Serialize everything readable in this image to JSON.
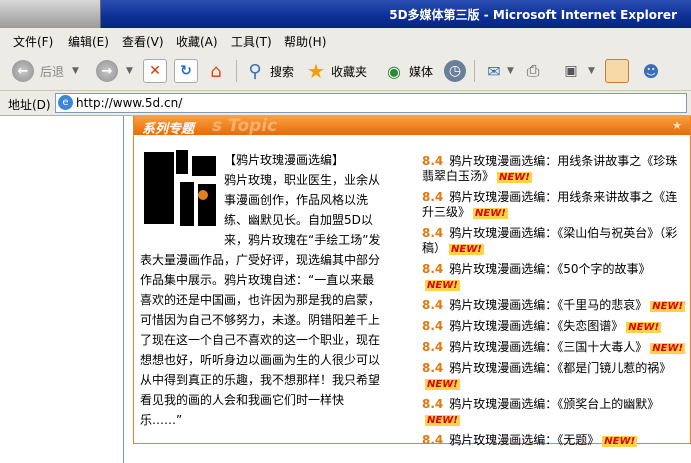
{
  "window": {
    "title": "5D多媒体第三版 - Microsoft Internet Explorer"
  },
  "menu": [
    {
      "label": "文件(F)"
    },
    {
      "label": "编辑(E)"
    },
    {
      "label": "查看(V)"
    },
    {
      "label": "收藏(A)"
    },
    {
      "label": "工具(T)"
    },
    {
      "label": "帮助(H)"
    }
  ],
  "toolbar": {
    "back_label": "后退",
    "search_label": "搜索",
    "favorites_label": "收藏夹",
    "media_label": "媒体"
  },
  "address": {
    "label": "地址(D)",
    "url": "http://www.5d.cn/"
  },
  "panel": {
    "title": "系列专题",
    "ghost_text": "s Topic",
    "deco": "★"
  },
  "article": {
    "heading": "【鸦片玫瑰漫画选编】",
    "body": "鸦片玫瑰，职业医生，业余从事漫画创作，作品风格以洗练、幽默见长。自加盟5D以来，鸦片玫瑰在“手绘工场”发表大量漫画作品，广受好评，现选编其中部分作品集中展示。鸦片玫瑰自述：“一直以来最喜欢的还是中国画，也许因为那是我的启蒙，可惜因为自己不够努力，未遂。阴错阳差千上了现在这一个自己不喜欢的这一个职业，现在想想也好，听听身边以画画为生的人很少可以从中得到真正的乐趣，我不想那样！我只希望看见我的画的人会和我画它们时一样快乐……”"
  },
  "list": {
    "version": "8.4",
    "new_badge": "NEW!",
    "items": [
      {
        "text": "鸦片玫瑰漫画选编：用线条讲故事之《珍珠翡翠白玉汤》"
      },
      {
        "text": "鸦片玫瑰漫画选编：用线条来讲故事之《连升三级》"
      },
      {
        "text": "鸦片玫瑰漫画选编：《梁山伯与祝英台》（彩稿）"
      },
      {
        "text": "鸦片玫瑰漫画选编：《50个字的故事》"
      },
      {
        "text": "鸦片玫瑰漫画选编：《千里马的悲哀》"
      },
      {
        "text": "鸦片玫瑰漫画选编：《失恋图谱》"
      },
      {
        "text": "鸦片玫瑰漫画选编：《三国十大毒人》"
      },
      {
        "text": "鸦片玫瑰漫画选编：《都是门镜儿惹的祸》"
      },
      {
        "text": "鸦片玫瑰漫画选编：《颁奖台上的幽默》"
      },
      {
        "text": "鸦片玫瑰漫画选编：《无题》"
      }
    ]
  },
  "colors": {
    "accent": "#ea6a08",
    "titlebar": "#0b2f94",
    "new_badge": "#e00000"
  }
}
